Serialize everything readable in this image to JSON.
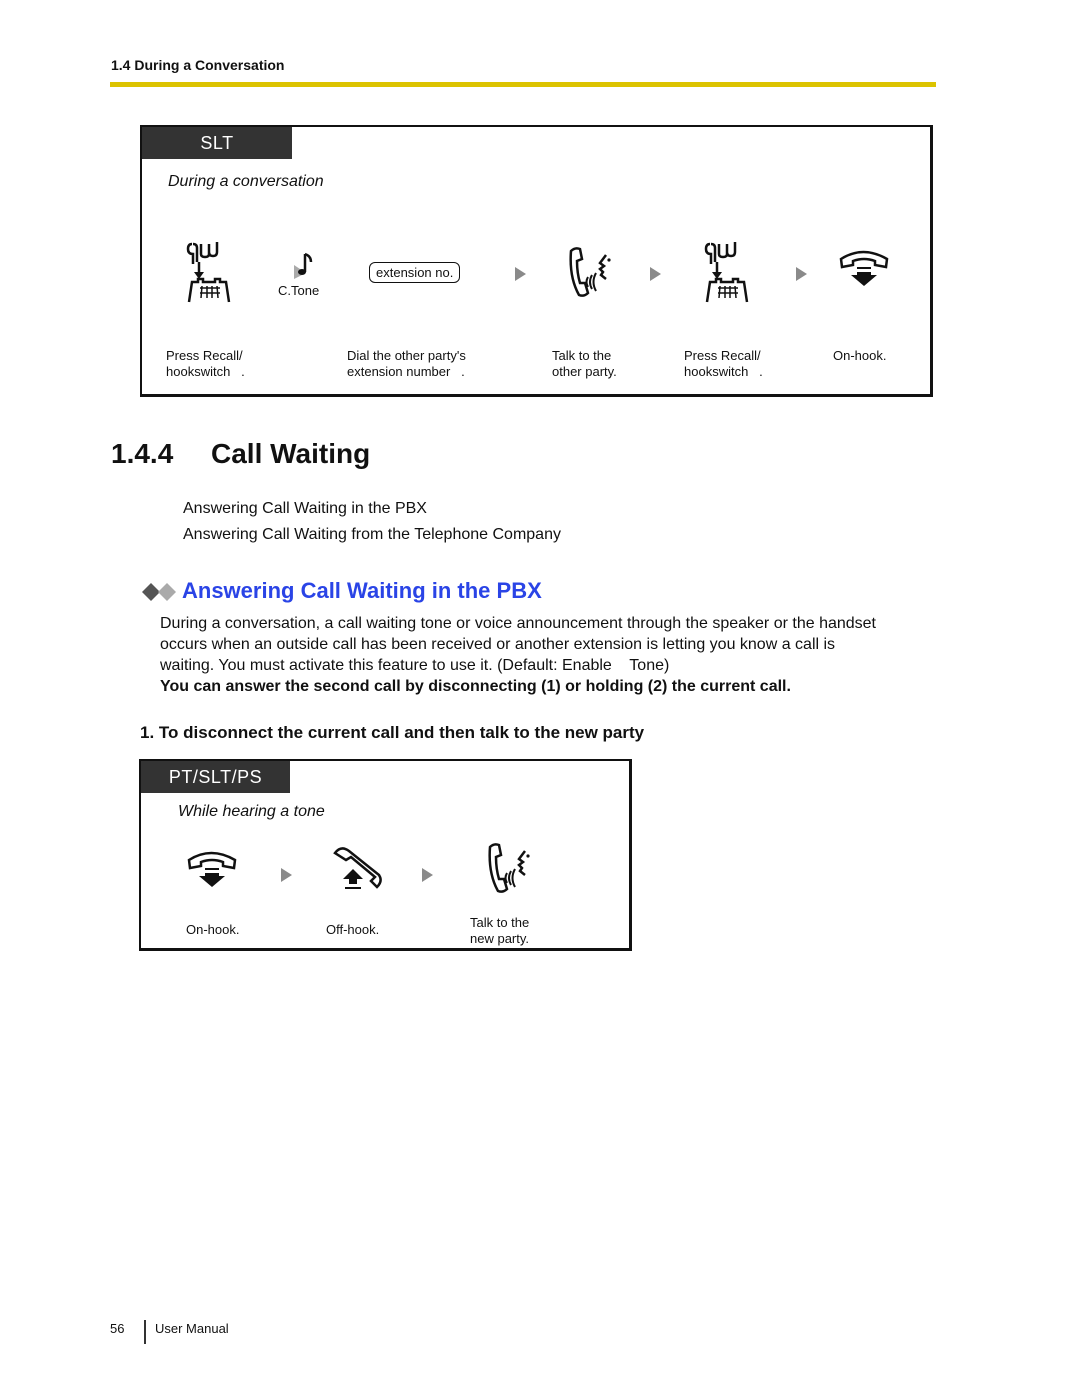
{
  "header": {
    "section": "1.4 During a Conversation",
    "rule_color": "#dcc300"
  },
  "slt_box": {
    "tag": "SLT",
    "subtitle": "During a conversation",
    "steps": [
      {
        "icon": "press-recall-hookswitch-icon",
        "caption": "Press Recall/\nhookswitch   ."
      },
      {
        "icon": "confirmation-tone-icon",
        "icon_label": "C.Tone",
        "caption": ""
      },
      {
        "icon": "extension-number-box",
        "box_label": "extension no.",
        "caption": "Dial the other party's\nextension number   ."
      },
      {
        "icon": "talk-icon",
        "caption": "Talk to the\nother party."
      },
      {
        "icon": "press-recall-hookswitch-icon",
        "caption": "Press Recall/\nhookswitch   ."
      },
      {
        "icon": "on-hook-icon",
        "caption": "On-hook."
      }
    ]
  },
  "section": {
    "number": "1.4.4",
    "title": "Call Waiting",
    "toc": [
      "Answering Call Waiting in the PBX",
      "Answering Call Waiting from the Telephone Company"
    ]
  },
  "subsection": {
    "title": "Answering Call Waiting in the PBX",
    "title_color": "#2a44e6",
    "para_lines": [
      "During a conversation, a call waiting tone or voice announcement through the speaker or the handset",
      "occurs when an outside call has been received or another extension is letting you know a call is",
      "waiting. You must activate this feature to use it. (Default: Enable    Tone)"
    ],
    "bold_line": "You can answer the second call by disconnecting (1) or holding (2) the current call."
  },
  "step1": {
    "heading": "1. To disconnect the current call and then talk to the new party",
    "tag": "PT/SLT/PS",
    "subtitle": "While hearing a tone",
    "steps": [
      {
        "icon": "on-hook-icon",
        "caption": "On-hook."
      },
      {
        "icon": "off-hook-icon",
        "caption": "Off-hook."
      },
      {
        "icon": "talk-icon",
        "caption": "Talk to the\nnew party."
      }
    ]
  },
  "footer": {
    "page_number": "56",
    "doc_title": "User Manual"
  }
}
